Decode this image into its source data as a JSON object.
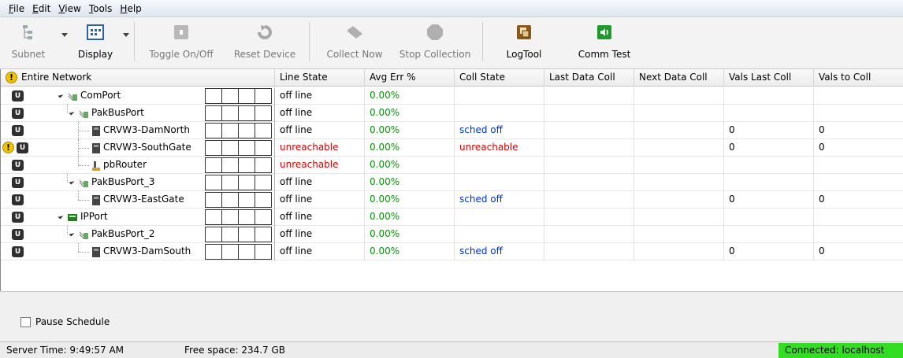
{
  "menu": [
    {
      "label": "File",
      "u": "F",
      "rest": "ile"
    },
    {
      "label": "Edit",
      "u": "E",
      "rest": "dit"
    },
    {
      "label": "View",
      "u": "V",
      "rest": "iew"
    },
    {
      "label": "Tools",
      "u": "T",
      "rest": "ools"
    },
    {
      "label": "Help",
      "u": "H",
      "rest": "elp"
    }
  ],
  "toolbar": {
    "subnet": "Subnet",
    "display": "Display",
    "toggle": "Toggle On/Off",
    "reset": "Reset Device",
    "collect": "Collect Now",
    "stop": "Stop Collection",
    "logtool": "LogTool",
    "commtest": "Comm Test"
  },
  "columns": {
    "tree": "Entire Network",
    "line_state": "Line State",
    "avg_err": "Avg Err %",
    "coll_state": "Coll State",
    "last_data": "Last Data Coll",
    "next_data": "Next Data Coll",
    "vals_last": "Vals Last Coll",
    "vals_to": "Vals to Coll"
  },
  "rows": [
    {
      "name": "ComPort",
      "line_state": "off line",
      "avg_err": "0.00%",
      "coll_state": "",
      "vals_last": "",
      "vals_to": ""
    },
    {
      "name": "PakBusPort",
      "line_state": "off line",
      "avg_err": "0.00%",
      "coll_state": "",
      "vals_last": "",
      "vals_to": ""
    },
    {
      "name": "CRVW3-DamNorth",
      "line_state": "off line",
      "avg_err": "0.00%",
      "coll_state": "sched off",
      "vals_last": "0",
      "vals_to": "0"
    },
    {
      "name": "CRVW3-SouthGate",
      "line_state": "unreachable",
      "avg_err": "0.00%",
      "coll_state": "unreachable",
      "vals_last": "0",
      "vals_to": "0"
    },
    {
      "name": "pbRouter",
      "line_state": "unreachable",
      "avg_err": "0.00%",
      "coll_state": "",
      "vals_last": "",
      "vals_to": ""
    },
    {
      "name": "PakBusPort_3",
      "line_state": "off line",
      "avg_err": "0.00%",
      "coll_state": "",
      "vals_last": "",
      "vals_to": ""
    },
    {
      "name": "CRVW3-EastGate",
      "line_state": "off line",
      "avg_err": "0.00%",
      "coll_state": "sched off",
      "vals_last": "0",
      "vals_to": "0"
    },
    {
      "name": "IPPort",
      "line_state": "off line",
      "avg_err": "0.00%",
      "coll_state": "",
      "vals_last": "",
      "vals_to": ""
    },
    {
      "name": "PakBusPort_2",
      "line_state": "off line",
      "avg_err": "0.00%",
      "coll_state": "",
      "vals_last": "",
      "vals_to": ""
    },
    {
      "name": "CRVW3-DamSouth",
      "line_state": "off line",
      "avg_err": "0.00%",
      "coll_state": "sched off",
      "vals_last": "0",
      "vals_to": "0"
    }
  ],
  "pause_label": "Pause Schedule",
  "status": {
    "server_time": "Server Time: 9:49:57 AM",
    "free_space": "Free space: 234.7 GB",
    "connection": "Connected: localhost"
  },
  "colors": {
    "ok": "#0a8f0a",
    "error": "#d40000",
    "info": "#0033cc",
    "connected": "#33dd22"
  }
}
